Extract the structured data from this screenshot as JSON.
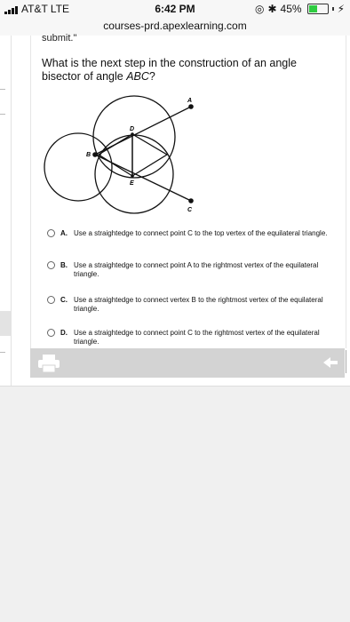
{
  "statusbar": {
    "carrier": "AT&T  LTE",
    "time": "6:42 PM",
    "battery": "45%",
    "battery_level": 0.45
  },
  "browser": {
    "url": "courses-prd.apexlearning.com"
  },
  "question": {
    "lead_text": "submit.\"",
    "prompt_prefix": "What is the next step in the construction of an angle bisector of angle ",
    "prompt_var": "ABC",
    "prompt_suffix": "?"
  },
  "figure": {
    "point_labels": [
      "A",
      "B",
      "C",
      "D",
      "E"
    ]
  },
  "choices": [
    {
      "letter": "A.",
      "text": "Use a straightedge to connect point C to the top vertex of the equilateral triangle."
    },
    {
      "letter": "B.",
      "text": "Use a straightedge to connect point A to the rightmost vertex of the equilateral triangle."
    },
    {
      "letter": "C.",
      "text": "Use a straightedge to connect vertex B to the rightmost vertex of the equilateral triangle."
    },
    {
      "letter": "D.",
      "text": "Use a straightedge to connect point C to the rightmost vertex of the equilateral triangle."
    }
  ],
  "colors": {
    "toolbar": "#d3d3d3",
    "background": "#f0f0f0",
    "battery": "#2ecc40"
  },
  "icons": [
    "signal-icon",
    "location-icon",
    "bluetooth-icon",
    "battery-icon",
    "charging-icon",
    "print-icon",
    "back-arrow-icon"
  ]
}
